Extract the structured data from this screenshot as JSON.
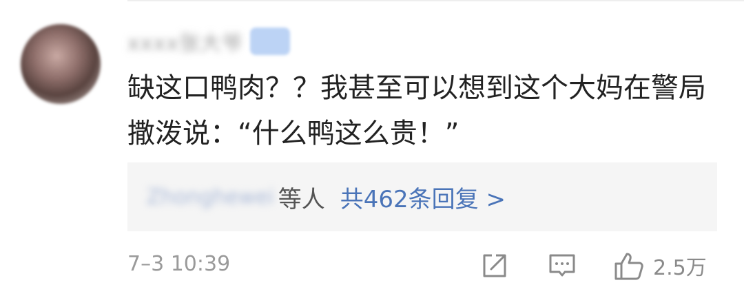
{
  "comment": {
    "username": "xxxx张大爷",
    "text": "缺这口鸭肉？？我甚至可以想到这个大妈在警局撒泼说：“什么鸭这么贵！”",
    "reply_preview": {
      "names": "Zhonghewei",
      "suffix": "等人",
      "link": "共462条回复 >"
    },
    "timestamp": "7–3 10:39",
    "likes": "2.5万"
  },
  "icons": {
    "share": "share-icon",
    "reply": "comment-icon",
    "like": "thumbs-up-icon"
  },
  "colors": {
    "text": "#222222",
    "link": "#4a74b8",
    "muted": "#9a9a9a",
    "reply_bg": "#f5f5f5"
  }
}
